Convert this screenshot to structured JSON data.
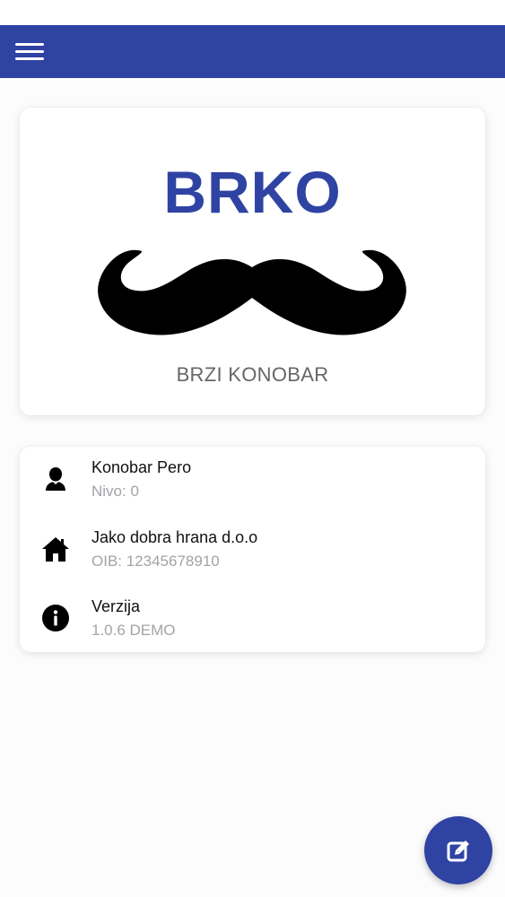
{
  "app_bar": {
    "menu_icon": "hamburger-menu-icon",
    "color": "#2f43a3"
  },
  "brand": {
    "title": "BRKO",
    "subtitle": "BRZI KONOBAR",
    "logo_icon": "mustache-icon",
    "title_color": "#2f43a3"
  },
  "info": {
    "user": {
      "icon": "person-icon",
      "name": "Konobar Pero",
      "level": "Nivo: 0"
    },
    "company": {
      "icon": "home-icon",
      "name": "Jako dobra hrana d.o.o",
      "oib": "OIB: 12345678910"
    },
    "version": {
      "icon": "info-icon",
      "label": "Verzija",
      "value": "1.0.6 DEMO"
    }
  },
  "fab": {
    "icon": "edit-icon",
    "color": "#2f43a3"
  }
}
